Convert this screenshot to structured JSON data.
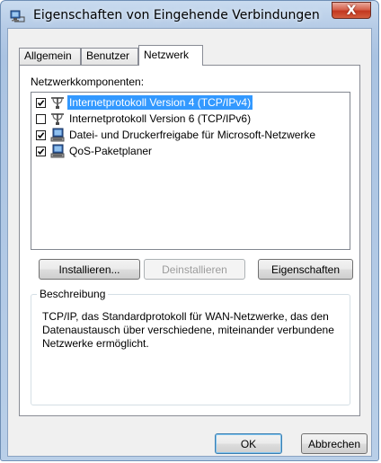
{
  "window": {
    "title": "Eigenschaften von Eingehende Verbindungen",
    "close_symbol": "X",
    "title_icon": "network-connection-icon",
    "colors": {
      "selection": "#3399ff",
      "close_button": "#c3371f",
      "frame": "#aac3e2"
    }
  },
  "tabs": [
    {
      "label": "Allgemein",
      "active": false
    },
    {
      "label": "Benutzer",
      "active": false
    },
    {
      "label": "Netzwerk",
      "active": true
    }
  ],
  "network": {
    "components_label": "Netzwerkkomponenten:",
    "components": [
      {
        "label": "Internetprotokoll Version 4 (TCP/IPv4)",
        "checked": true,
        "selected": true,
        "icon": "protocol-icon"
      },
      {
        "label": "Internetprotokoll Version 6 (TCP/IPv6)",
        "checked": false,
        "selected": false,
        "icon": "protocol-icon"
      },
      {
        "label": "Datei- und Druckerfreigabe für Microsoft-Netzwerke",
        "checked": true,
        "selected": false,
        "icon": "service-icon"
      },
      {
        "label": "QoS-Paketplaner",
        "checked": true,
        "selected": false,
        "icon": "service-icon"
      }
    ],
    "buttons": {
      "install": "Installieren...",
      "uninstall": "Deinstallieren",
      "properties": "Eigenschaften"
    },
    "description": {
      "title": "Beschreibung",
      "text": "TCP/IP, das Standardprotokoll für WAN-Netzwerke, das den Datenaustausch über verschiedene, miteinander verbundene Netzwerke ermöglicht."
    }
  },
  "dialog_buttons": {
    "ok": "OK",
    "cancel": "Abbrechen"
  }
}
